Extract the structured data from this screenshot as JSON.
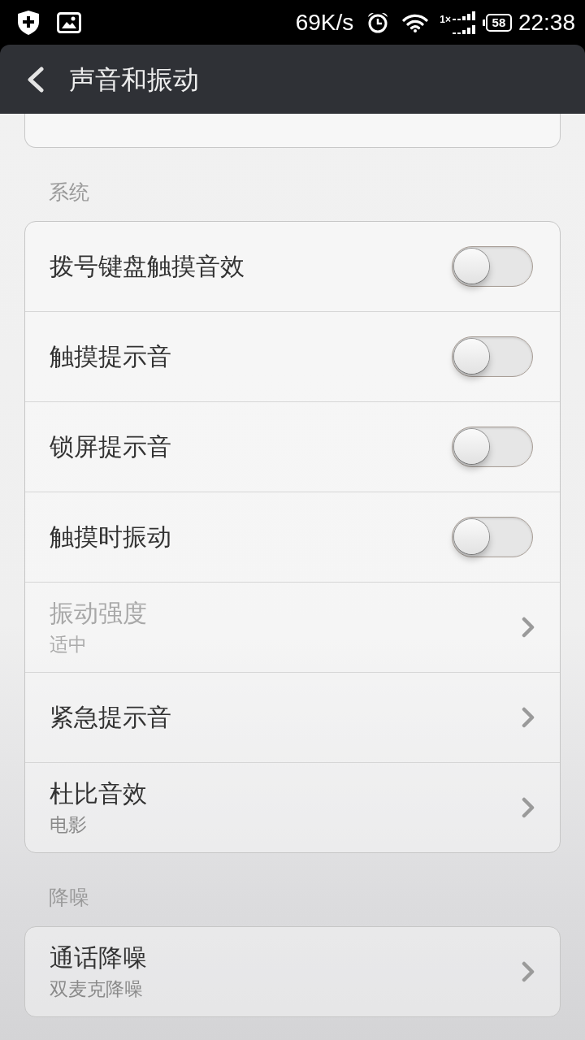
{
  "status_bar": {
    "speed": "69K/s",
    "signal_label": "1×",
    "battery": "58",
    "time": "22:38"
  },
  "header": {
    "title": "声音和振动"
  },
  "sections": [
    {
      "title": "系统",
      "items": [
        {
          "kind": "switch",
          "label": "拨号键盘触摸音效",
          "on": false
        },
        {
          "kind": "switch",
          "label": "触摸提示音",
          "on": false
        },
        {
          "kind": "switch",
          "label": "锁屏提示音",
          "on": false
        },
        {
          "kind": "switch",
          "label": "触摸时振动",
          "on": false
        },
        {
          "kind": "link",
          "label": "振动强度",
          "value": "适中",
          "disabled": true
        },
        {
          "kind": "link",
          "label": "紧急提示音",
          "disabled": false
        },
        {
          "kind": "link",
          "label": "杜比音效",
          "value": "电影",
          "disabled": false
        }
      ]
    },
    {
      "title": "降噪",
      "items": [
        {
          "kind": "link",
          "label": "通话降噪",
          "value": "双麦克降噪",
          "disabled": false
        }
      ]
    }
  ]
}
